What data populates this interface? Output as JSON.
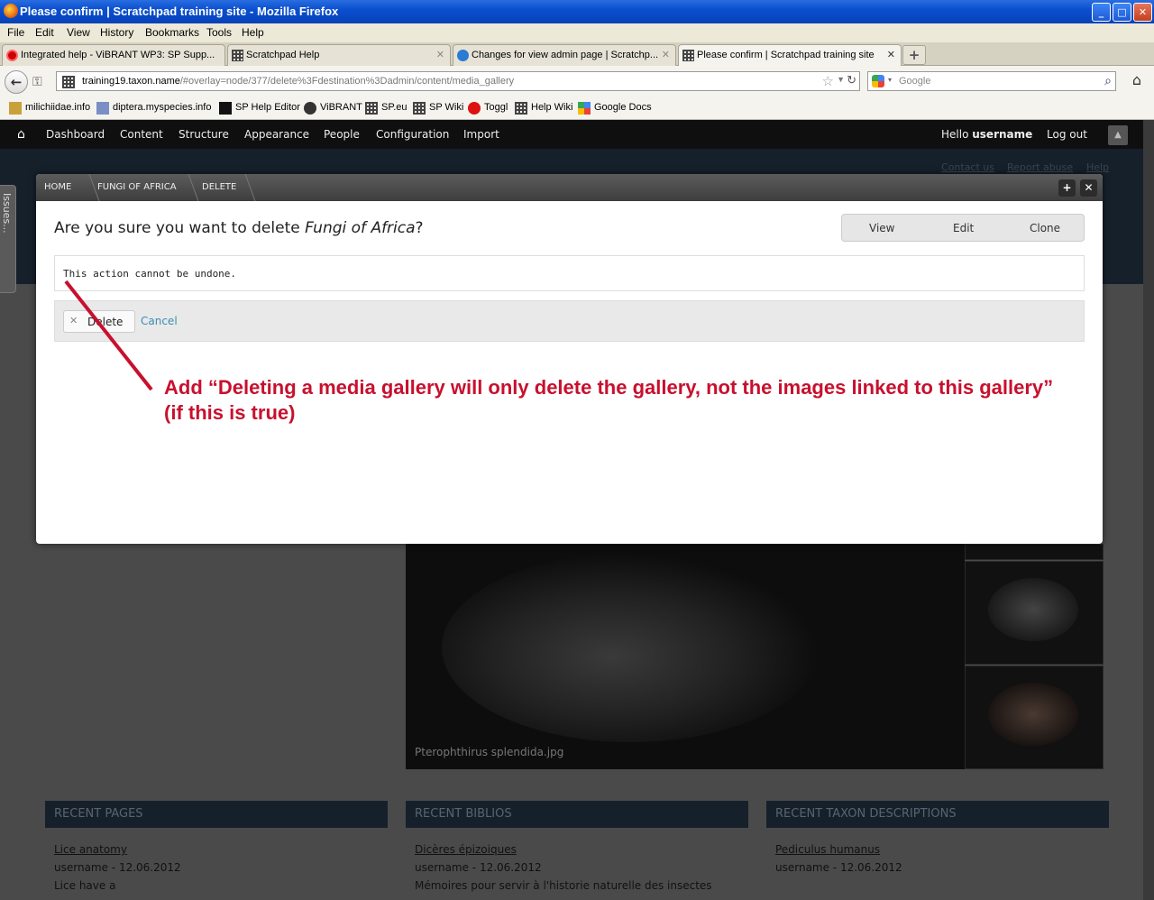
{
  "window": {
    "title": "Please confirm | Scratchpad training site - Mozilla Firefox",
    "min": "_",
    "max": "□",
    "close": "✕"
  },
  "menu": [
    "File",
    "Edit",
    "View",
    "History",
    "Bookmarks",
    "Tools",
    "Help"
  ],
  "tabs": [
    {
      "label": "Integrated help - ViBRANT WP3: SP Supp..."
    },
    {
      "label": "Scratchpad Help"
    },
    {
      "label": "Changes for view admin page | Scratchp..."
    },
    {
      "label": "Please confirm | Scratchpad training site"
    }
  ],
  "newtab": "+",
  "url": {
    "host": "training19.taxon.name",
    "path": "/#overlay=node/377/delete%3Fdestination%3Dadmin/content/media_gallery"
  },
  "search": {
    "placeholder": "Google"
  },
  "bookmarks": [
    "milichiidae.info",
    "diptera.myspecies.info",
    "SP Help Editor",
    "ViBRANT",
    "SP.eu",
    "SP Wiki",
    "Toggl",
    "Help Wiki",
    "Google Docs"
  ],
  "admin": {
    "items": [
      "Dashboard",
      "Content",
      "Structure",
      "Appearance",
      "People",
      "Configuration",
      "Import"
    ],
    "hello": "Hello",
    "username": "username",
    "logout": "Log out"
  },
  "toplinks": [
    "Contact us",
    "Report abuse",
    "Help"
  ],
  "issues": "Issues...",
  "overlay": {
    "breadcrumb": [
      "HOME",
      "FUNGI OF AFRICA",
      "DELETE"
    ],
    "title_prefix": "Are you sure you want to delete ",
    "title_node": "Fungi of Africa",
    "title_suffix": "?",
    "tabs": [
      "View",
      "Edit",
      "Clone"
    ],
    "message": "This action cannot be undone.",
    "delete_label": "Delete",
    "cancel_label": "Cancel"
  },
  "gallery": {
    "caption": "Pterophthirus splendida.jpg"
  },
  "blocks": [
    {
      "title": "RECENT PAGES",
      "link": "Lice anatomy",
      "meta": "username - 12.06.2012",
      "snippet": "Lice have a"
    },
    {
      "title": "RECENT BIBLIOS",
      "link": "Dicères épizoiques",
      "meta": "username - 12.06.2012",
      "snippet": "Mémoires pour servir à l'historie naturelle des insectes"
    },
    {
      "title": "RECENT TAXON DESCRIPTIONS",
      "link": "Pediculus humanus",
      "meta": "username - 12.06.2012",
      "snippet": ""
    }
  ],
  "annotation": {
    "line1": "Add “Deleting a media gallery will only delete the gallery, not the images linked to this gallery”",
    "line2": "(if this is true)",
    "color": "#c8102e"
  }
}
